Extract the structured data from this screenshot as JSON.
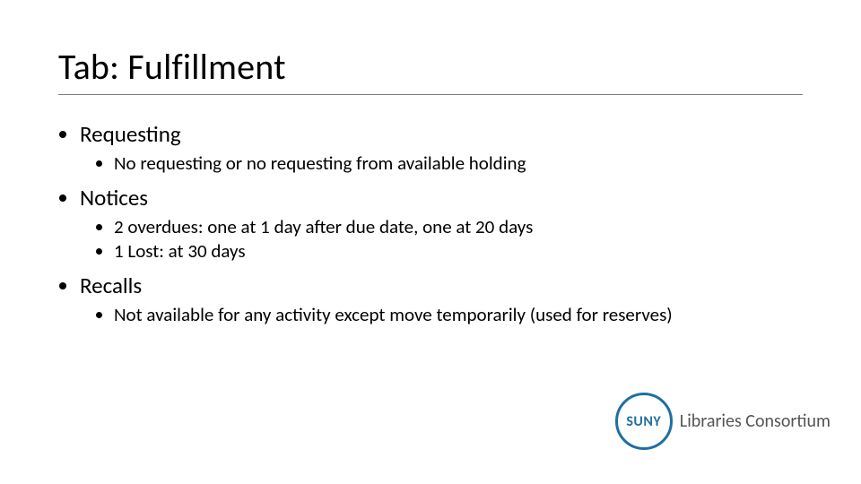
{
  "title": "Tab: Fulfillment",
  "bullets": [
    {
      "label": "Requesting",
      "sub": [
        "No requesting or no requesting from available holding"
      ]
    },
    {
      "label": "Notices",
      "sub": [
        "2 overdues: one at 1 day after due date, one at 20 days",
        "1 Lost: at 30 days"
      ]
    },
    {
      "label": "Recalls",
      "sub": [
        "Not available for any activity except move temporarily (used for reserves)"
      ]
    }
  ],
  "logo": {
    "circle": "SUNY",
    "text": "Libraries Consortium"
  }
}
